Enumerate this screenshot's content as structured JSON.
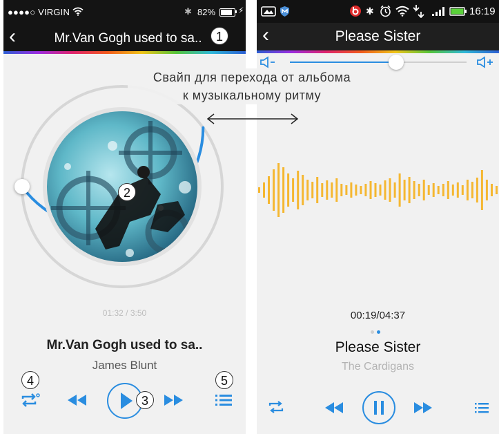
{
  "left": {
    "status": {
      "carrier": "●●●●○ VIRGIN",
      "battery": "82%",
      "battery_level": 0.82
    },
    "title": "Mr.Van Gogh used to sa..",
    "callouts": [
      "1",
      "2",
      "3",
      "4",
      "5"
    ],
    "progress": {
      "elapsed": "01:32 / 3:50",
      "fraction": 0.4
    },
    "song": "Mr.Van Gogh used to sa..",
    "artist": "James Blunt",
    "icons": [
      "back-icon",
      "repeat-icon",
      "previous-icon",
      "play-icon",
      "next-icon",
      "playlist-icon"
    ],
    "accent": "#2a8de0"
  },
  "right": {
    "status": {
      "time": "16:19"
    },
    "title": "Please Sister",
    "volume": {
      "fraction": 0.6
    },
    "time": "00:19/04:37",
    "song": "Please Sister",
    "artist": "The Cardigans",
    "page_dots": 2,
    "active_dot": 1,
    "wave_color": "#f5b731",
    "accent": "#2a8de0"
  },
  "caption": {
    "line1": "Свайп для перехода от альбома",
    "line2": "к музыкальному ритму"
  }
}
